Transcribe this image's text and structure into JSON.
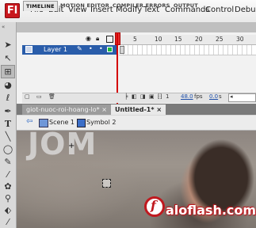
{
  "app": {
    "logo_letter": "Fl",
    "accent": "#c8171d"
  },
  "menu": [
    "File",
    "Edit",
    "View",
    "Insert",
    "Modify",
    "Text",
    "Commands",
    "Control",
    "Debug"
  ],
  "panel_tabs": [
    "TIMELINE",
    "MOTION EDITOR",
    "COMPILER ERRORS",
    "OUTPUT"
  ],
  "timeline": {
    "frame_numbers": [
      "5",
      "10",
      "15",
      "20",
      "25",
      "30"
    ],
    "layer_name": "Layer 1",
    "current_frame": "1",
    "fps": "48.0",
    "fps_unit": "fps",
    "time": "0.0",
    "time_unit": "s"
  },
  "documents": {
    "tabs": [
      "giot-nuoc-roi-hoang-lo*",
      "Untitled-1*"
    ],
    "close_glyph": "×"
  },
  "editbar": {
    "scene": "Scene 1",
    "symbol": "Symbol 2"
  },
  "stage": {
    "watermark": "JOM",
    "logo_letter": "f",
    "logo_text": "aloflash.com"
  }
}
